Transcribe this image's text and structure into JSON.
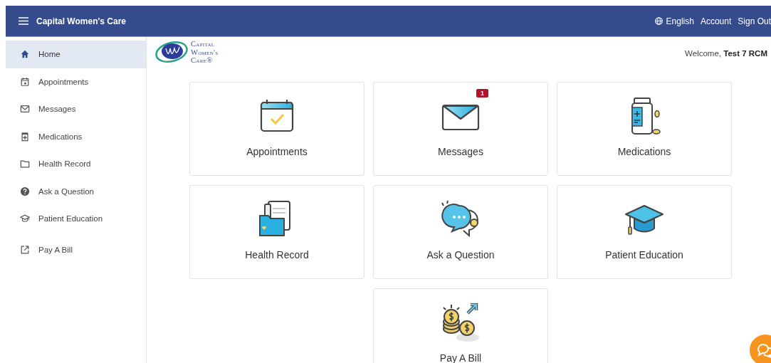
{
  "header": {
    "title": "Capital Women's Care",
    "language": "English",
    "links": [
      "Account",
      "Sign Out"
    ]
  },
  "sidebar": {
    "items": [
      {
        "kind": "home",
        "label": "Home",
        "selected": true
      },
      {
        "kind": "calendar",
        "label": "Appointments",
        "selected": false
      },
      {
        "kind": "envelope",
        "label": "Messages",
        "selected": false
      },
      {
        "kind": "medicine",
        "label": "Medications",
        "selected": false
      },
      {
        "kind": "folder",
        "label": "Health Record",
        "selected": false
      },
      {
        "kind": "help",
        "label": "Ask a Question",
        "selected": false
      },
      {
        "kind": "cap",
        "label": "Patient Education",
        "selected": false
      },
      {
        "kind": "external",
        "label": "Pay A Bill",
        "selected": false
      }
    ]
  },
  "logo": {
    "lines": [
      "Capital",
      "Women's",
      "Care®"
    ]
  },
  "welcome": {
    "greeting": "Welcome,",
    "user": "Test 7 RCM"
  },
  "tiles": [
    {
      "kind": "calendar",
      "label": "Appointments"
    },
    {
      "kind": "envelope",
      "label": "Messages",
      "badge": "1"
    },
    {
      "kind": "bottle",
      "label": "Medications"
    },
    {
      "kind": "folder",
      "label": "Health Record"
    },
    {
      "kind": "chat",
      "label": "Ask a Question"
    },
    {
      "kind": "cap",
      "label": "Patient Education"
    },
    {
      "kind": "coins",
      "label": "Pay A Bill"
    }
  ]
}
